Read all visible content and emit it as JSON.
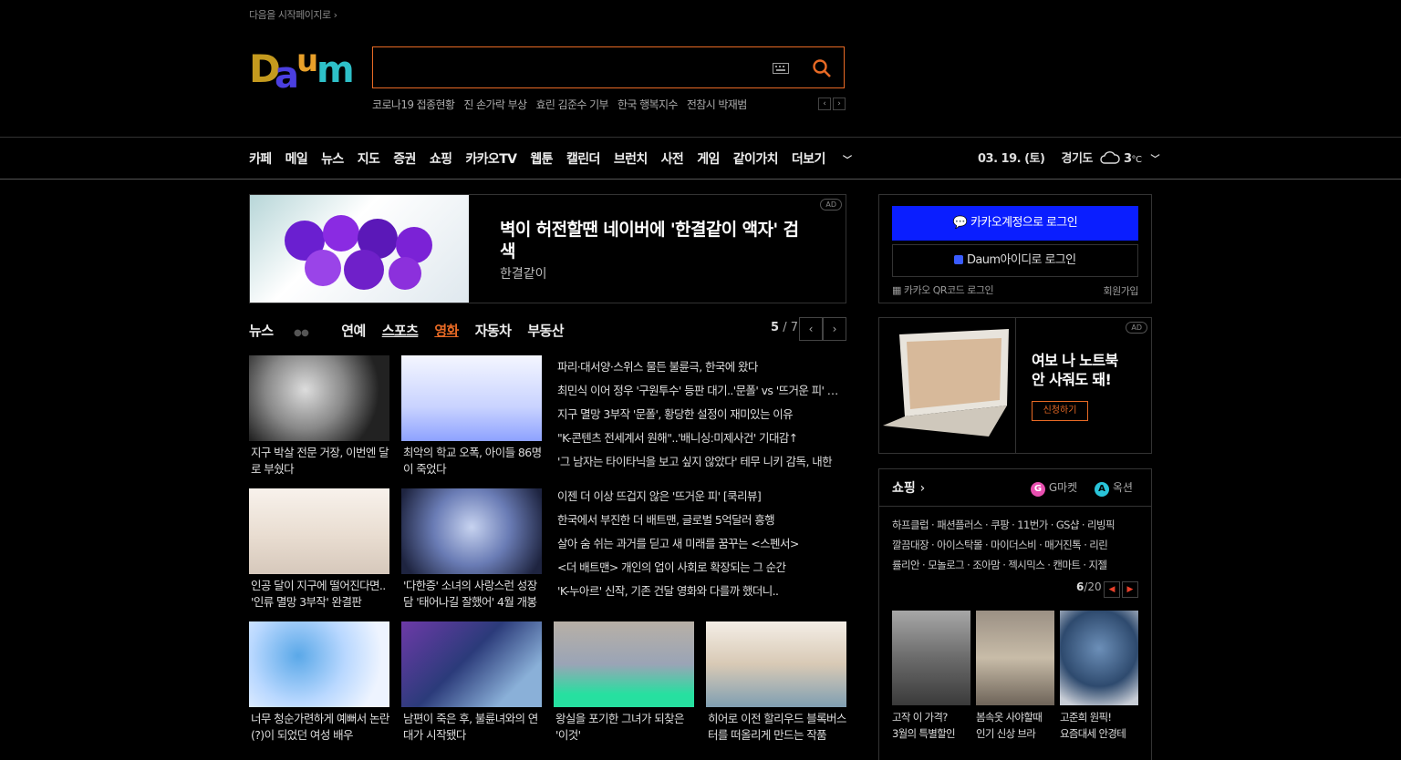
{
  "top_link": "다음을 시작페이지로",
  "search": {
    "placeholder": ""
  },
  "trends": [
    "코로나19 접종현황",
    "진 손가락 부상",
    "효린 김준수 기부",
    "한국 행복지수",
    "전참시 박재범"
  ],
  "nav": [
    "카페",
    "메일",
    "뉴스",
    "지도",
    "증권",
    "쇼핑",
    "카카오TV",
    "웹툰",
    "캘린더",
    "브런치",
    "사전",
    "게임",
    "같이가치",
    "더보기"
  ],
  "date": "03. 19. (토)",
  "weather": {
    "region": "경기도",
    "temp": "3",
    "unit": "°C"
  },
  "ad1": {
    "badge": "AD",
    "title": "벽이 허전할땐 네이버에 '한결같이 액자' 검색",
    "sub": "한결같이"
  },
  "tabs": [
    "뉴스",
    "연예",
    "스포츠",
    "영화",
    "자동차",
    "부동산"
  ],
  "pager": {
    "current": "5",
    "total": "/ 7"
  },
  "cards_top": [
    {
      "caption": "지구 박살 전문 거장, 이번엔 달로 부쉈다"
    },
    {
      "caption": "최악의 학교 오폭, 아이들 86명이 죽었다"
    }
  ],
  "cards_mid": [
    {
      "caption": "인공 달이 지구에 떨어진다면.. '인류 멸망 3부작' 완결판"
    },
    {
      "caption": "'다한증' 소녀의 사랑스런 성장담 '태어나길 잘했어' 4월 개봉"
    }
  ],
  "headlines_a": [
    "파리·대서양·스위스 물든 불륜극, 한국에 왔다",
    "최민식 이어 정우 '구원투수' 등판 대기..'문폴' vs '뜨거운 피' 빅매치",
    "지구 멸망 3부작 '문폴', 황당한 설정이 재미있는 이유",
    "\"K-콘텐츠 전세계서 원해\"..'배니싱:미제사건' 기대감↑",
    "'그 남자는 타이타닉을 보고 싶지 않았다' 테무 니키 감독, 내한"
  ],
  "headlines_b": [
    "이젠 더 이상 뜨겁지 않은 '뜨거운 피' [쿡리뷰]",
    "한국에서 부진한 더 배트맨, 글로벌 5억달러 흥행",
    "살아 숨 쉬는 과거를 딛고 새 미래를 꿈꾸는 <스펜서>",
    "<더 배트맨> 개인의 업이 사회로 확장되는 그 순간",
    "'K-누아르' 신작, 기존 건달 영화와 다를까 했더니.."
  ],
  "cards_bottom": [
    {
      "caption": "너무 청순가련하게 예뻐서 논란(?)이 되었던 여성 배우"
    },
    {
      "caption": "남편이 죽은 후, 불륜녀와의 연대가 시작됐다"
    },
    {
      "caption": "왕실을 포기한 그녀가 되찾은 '이것'"
    },
    {
      "caption": "히어로 이전 할리우드 블록버스터를 떠올리게 만드는 작품"
    }
  ],
  "login": {
    "kakao": "카카오계정으로 로그인",
    "daum": "Daum아이디로 로그인",
    "qr": "카카오 QR코드 로그인",
    "join": "회원가입"
  },
  "ad2": {
    "badge": "AD",
    "title": "여보 나 노트북 안 사줘도 돼!",
    "cta": "신청하기"
  },
  "shopping": {
    "title": "쇼핑",
    "gmarket": "G마켓",
    "auction": "옥션",
    "links": [
      "하프클럽 · 패션플러스 · 쿠팡 · 11번가 · GS샵 · 리빙픽",
      "깔끔대장 · 아이스탁몰 · 마이더스비 · 매거진톡 · 리린",
      "률리안 · 모놀로그 · 조아맘 · 젝시믹스 · 캔마트 · 지젤"
    ],
    "page": "6",
    "total": "/20",
    "items": [
      {
        "caption": "고작 이 가격?",
        "caption2": "3월의 특별할인"
      },
      {
        "caption": "봄속옷 사야할때",
        "caption2": "인기 신상 브라"
      },
      {
        "caption": "고준희 원픽!",
        "caption2": "요즘대세 안경테"
      }
    ]
  },
  "colors": {
    "accent": "#e86a25",
    "kakao_blue": "#0a1eff",
    "bg": "#000000"
  }
}
